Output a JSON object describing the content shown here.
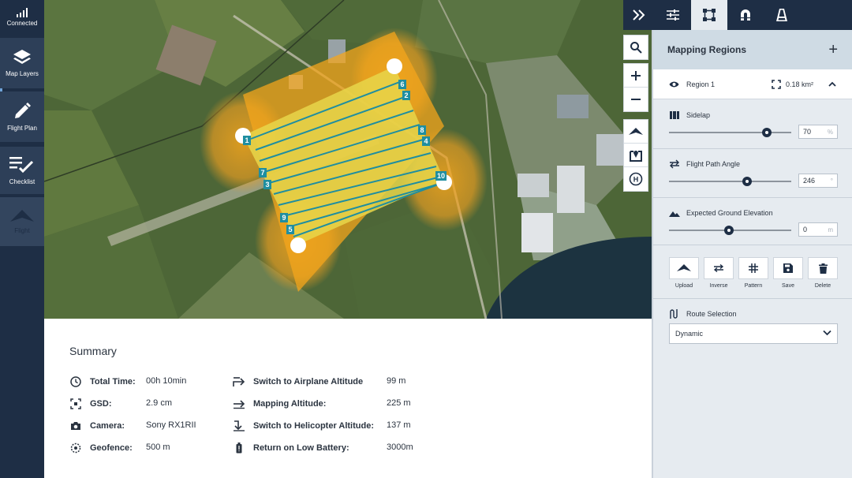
{
  "sidebar": {
    "items": [
      {
        "label": "Connected",
        "icon": "signal-bars-icon"
      },
      {
        "label": "Map Layers",
        "icon": "layers-icon"
      },
      {
        "label": "Flight Plan",
        "icon": "pencil-icon"
      },
      {
        "label": "Checklist",
        "icon": "checklist-icon"
      },
      {
        "label": "Flight",
        "icon": "aircraft-icon"
      }
    ]
  },
  "panel_tabs": [
    "collapse-panel-icon",
    "tune-sliders-icon",
    "polygon-select-icon",
    "magnet-icon",
    "road-icon"
  ],
  "panel": {
    "title": "Mapping Regions",
    "add_label": "+",
    "region": {
      "name": "Region 1",
      "area": "0.18 km²"
    },
    "sidelap": {
      "label": "Sidelap",
      "value": "70",
      "unit": "%",
      "level": 0.8
    },
    "flight_path_angle": {
      "label": "Flight Path Angle",
      "value": "246",
      "unit": "°",
      "level": 0.64
    },
    "ground_elevation": {
      "label": "Expected Ground Elevation",
      "value": "0",
      "unit": "m",
      "level": 0.49
    },
    "actions": [
      "Upload",
      "Inverse",
      "Pattern",
      "Save",
      "Delete"
    ],
    "route_selection": {
      "label": "Route Selection",
      "value": "Dynamic"
    }
  },
  "map": {
    "waypoints": [
      "1",
      "2",
      "3",
      "4",
      "5",
      "6",
      "7",
      "8",
      "9",
      "10"
    ],
    "controls": [
      "search-icon",
      "zoom-in-icon",
      "zoom-out-icon",
      "aircraft-icon",
      "map-pin-icon",
      "helipad-icon"
    ]
  },
  "summary": {
    "title": "Summary",
    "left": [
      {
        "key": "Total Time:",
        "value": "00h 10min",
        "icon": "clock-icon"
      },
      {
        "key": "GSD:",
        "value": "2.9 cm",
        "icon": "gsd-icon"
      },
      {
        "key": "Camera:",
        "value": "Sony RX1RII",
        "icon": "camera-icon"
      },
      {
        "key": "Geofence:",
        "value": "500 m",
        "icon": "geofence-icon"
      }
    ],
    "right": [
      {
        "key": "Switch to Airplane Altitude",
        "value": "99 m",
        "icon": "arrow-turn-up-icon"
      },
      {
        "key": "Mapping Altitude:",
        "value": "225 m",
        "icon": "arrow-right-icon"
      },
      {
        "key": "Switch to Helicopter Altitude:",
        "value": "137 m",
        "icon": "arrow-down-icon"
      },
      {
        "key": "Return on Low Battery:",
        "value": "3000m",
        "icon": "battery-icon"
      }
    ]
  }
}
